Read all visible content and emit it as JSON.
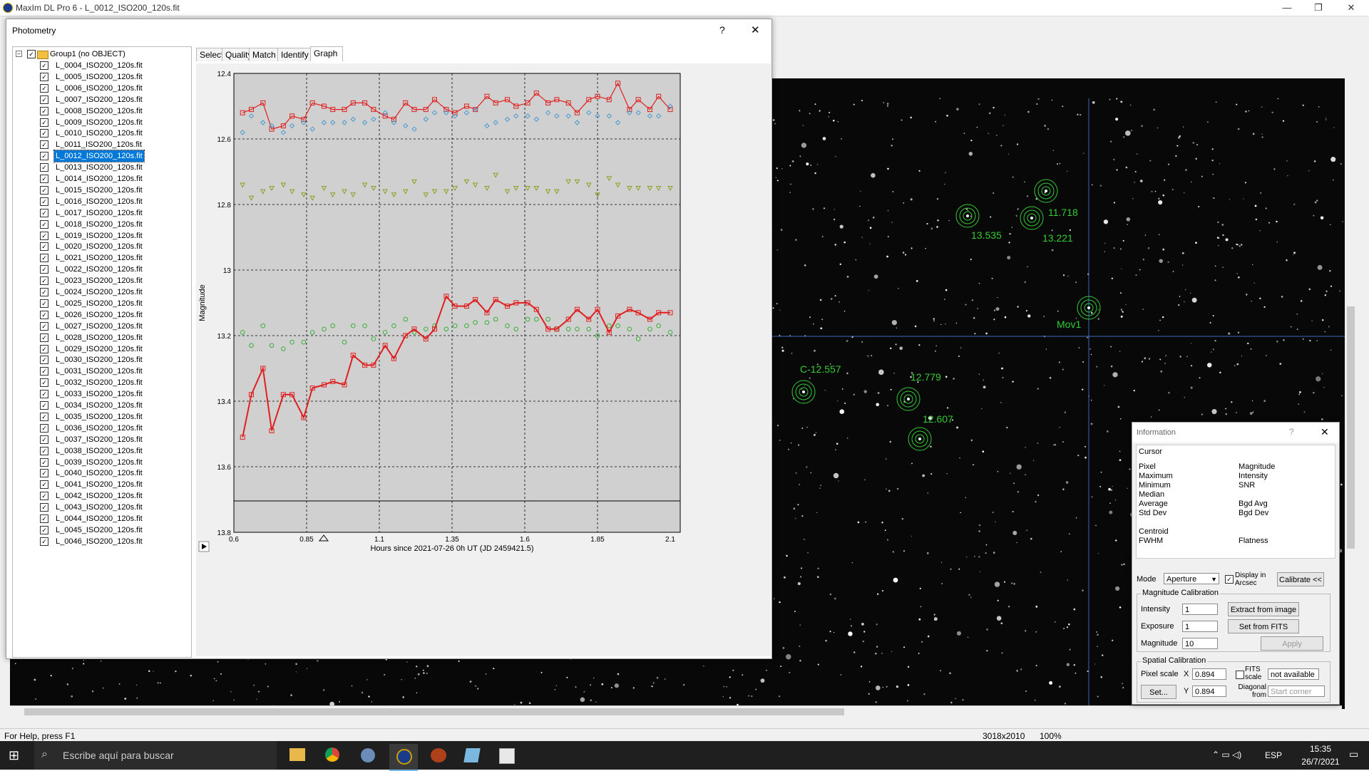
{
  "app": {
    "title": "MaxIm DL Pro 6 - L_0012_ISO200_120s.fit",
    "minimize": "—",
    "restore": "❐",
    "close": "✕"
  },
  "statusbar": {
    "help": "For Help, press F1",
    "dims": "3018x2010",
    "zoom": "100%"
  },
  "taskbar": {
    "search_placeholder": "Escribe aquí para buscar",
    "lang": "ESP",
    "time": "15:35",
    "date": "26/7/2021"
  },
  "photometry": {
    "title": "Photometry",
    "help": "?",
    "close": "✕",
    "group_label": "Group1 (no OBJECT)",
    "selected_index": 8,
    "files": [
      "L_0004_ISO200_120s.fit",
      "L_0005_ISO200_120s.fit",
      "L_0006_ISO200_120s.fit",
      "L_0007_ISO200_120s.fit",
      "L_0008_ISO200_120s.fit",
      "L_0009_ISO200_120s.fit",
      "L_0010_ISO200_120s.fit",
      "L_0011_ISO200_120s.fit",
      "L_0012_ISO200_120s.fit",
      "L_0013_ISO200_120s.fit",
      "L_0014_ISO200_120s.fit",
      "L_0015_ISO200_120s.fit",
      "L_0016_ISO200_120s.fit",
      "L_0017_ISO200_120s.fit",
      "L_0018_ISO200_120s.fit",
      "L_0019_ISO200_120s.fit",
      "L_0020_ISO200_120s.fit",
      "L_0021_ISO200_120s.fit",
      "L_0022_ISO200_120s.fit",
      "L_0023_ISO200_120s.fit",
      "L_0024_ISO200_120s.fit",
      "L_0025_ISO200_120s.fit",
      "L_0026_ISO200_120s.fit",
      "L_0027_ISO200_120s.fit",
      "L_0028_ISO200_120s.fit",
      "L_0029_ISO200_120s.fit",
      "L_0030_ISO200_120s.fit",
      "L_0031_ISO200_120s.fit",
      "L_0032_ISO200_120s.fit",
      "L_0033_ISO200_120s.fit",
      "L_0034_ISO200_120s.fit",
      "L_0035_ISO200_120s.fit",
      "L_0036_ISO200_120s.fit",
      "L_0037_ISO200_120s.fit",
      "L_0038_ISO200_120s.fit",
      "L_0039_ISO200_120s.fit",
      "L_0040_ISO200_120s.fit",
      "L_0041_ISO200_120s.fit",
      "L_0042_ISO200_120s.fit",
      "L_0043_ISO200_120s.fit",
      "L_0044_ISO200_120s.fit",
      "L_0045_ISO200_120s.fit",
      "L_0046_ISO200_120s.fit"
    ],
    "tabs": [
      "Select",
      "Quality",
      "Match",
      "Identify",
      "Graph"
    ],
    "active_tab": "Graph"
  },
  "chart_data": {
    "type": "scatter",
    "xlabel": "Hours since 2021-07-26 0h UT (JD 2459421.5)",
    "ylabel": "Magnitude",
    "xlim": [
      0.6,
      2.1
    ],
    "ylim": [
      12.4,
      13.8
    ],
    "y_inverted": true,
    "x_ticks": [
      "0.6",
      "0.85",
      "1.1",
      "1.35",
      "1.6",
      "1.85",
      "2.1"
    ],
    "y_ticks": [
      "12.4",
      "12.6",
      "12.8",
      "13",
      "13.2",
      "13.4",
      "13.6",
      "13.8"
    ],
    "grid": true,
    "background": "#d0d0d0",
    "series": [
      {
        "marker": "square-line",
        "color": "#e02020",
        "x": [
          0.63,
          0.66,
          0.7,
          0.73,
          0.77,
          0.8,
          0.84,
          0.87,
          0.91,
          0.94,
          0.98,
          1.01,
          1.05,
          1.08,
          1.12,
          1.15,
          1.19,
          1.22,
          1.26,
          1.29,
          1.33,
          1.36,
          1.4,
          1.43,
          1.47,
          1.5,
          1.54,
          1.57,
          1.61,
          1.64,
          1.68,
          1.71,
          1.75,
          1.78,
          1.82,
          1.85,
          1.89,
          1.92,
          1.96,
          1.99,
          2.03,
          2.06,
          2.1
        ],
        "y": [
          12.52,
          12.51,
          12.49,
          12.57,
          12.56,
          12.53,
          12.54,
          12.49,
          12.5,
          12.51,
          12.51,
          12.49,
          12.49,
          12.51,
          12.53,
          12.54,
          12.49,
          12.51,
          12.51,
          12.48,
          12.51,
          12.52,
          12.5,
          12.51,
          12.47,
          12.49,
          12.48,
          12.5,
          12.49,
          12.46,
          12.49,
          12.48,
          12.49,
          12.52,
          12.48,
          12.47,
          12.48,
          12.43,
          12.51,
          12.48,
          12.51,
          12.47,
          12.51
        ]
      },
      {
        "marker": "diamond",
        "color": "#4a9ad0",
        "x": [
          0.63,
          0.66,
          0.7,
          0.73,
          0.77,
          0.8,
          0.84,
          0.87,
          0.91,
          0.94,
          0.98,
          1.01,
          1.05,
          1.08,
          1.12,
          1.15,
          1.19,
          1.22,
          1.26,
          1.29,
          1.33,
          1.36,
          1.4,
          1.43,
          1.47,
          1.5,
          1.54,
          1.57,
          1.61,
          1.64,
          1.68,
          1.71,
          1.75,
          1.78,
          1.82,
          1.85,
          1.89,
          1.92,
          1.96,
          1.99,
          2.03,
          2.06,
          2.1
        ],
        "y": [
          12.58,
          12.53,
          12.55,
          12.56,
          12.58,
          12.56,
          12.55,
          12.57,
          12.55,
          12.55,
          12.55,
          12.54,
          12.55,
          12.54,
          12.52,
          12.55,
          12.56,
          12.57,
          12.54,
          12.52,
          12.52,
          12.53,
          12.52,
          12.51,
          12.56,
          12.55,
          12.54,
          12.53,
          12.53,
          12.54,
          12.52,
          12.53,
          12.53,
          12.55,
          12.52,
          12.53,
          12.53,
          12.55,
          12.52,
          12.52,
          12.53,
          12.53,
          12.5
        ]
      },
      {
        "marker": "triangle",
        "color": "#8aa020",
        "x": [
          0.63,
          0.66,
          0.7,
          0.73,
          0.77,
          0.8,
          0.84,
          0.87,
          0.91,
          0.94,
          0.98,
          1.01,
          1.05,
          1.08,
          1.12,
          1.15,
          1.19,
          1.22,
          1.26,
          1.29,
          1.33,
          1.36,
          1.4,
          1.43,
          1.47,
          1.5,
          1.54,
          1.57,
          1.61,
          1.64,
          1.68,
          1.71,
          1.75,
          1.78,
          1.82,
          1.85,
          1.89,
          1.92,
          1.96,
          1.99,
          2.03,
          2.06,
          2.1
        ],
        "y": [
          12.74,
          12.78,
          12.76,
          12.75,
          12.74,
          12.76,
          12.77,
          12.78,
          12.75,
          12.77,
          12.76,
          12.77,
          12.74,
          12.75,
          12.76,
          12.77,
          12.76,
          12.73,
          12.77,
          12.76,
          12.76,
          12.75,
          12.73,
          12.74,
          12.75,
          12.71,
          12.76,
          12.75,
          12.75,
          12.75,
          12.76,
          12.76,
          12.73,
          12.73,
          12.74,
          12.77,
          12.72,
          12.74,
          12.75,
          12.75,
          12.75,
          12.75,
          12.75
        ]
      },
      {
        "marker": "circle",
        "color": "#38b038",
        "x": [
          0.63,
          0.66,
          0.7,
          0.73,
          0.77,
          0.8,
          0.84,
          0.87,
          0.91,
          0.94,
          0.98,
          1.01,
          1.05,
          1.08,
          1.12,
          1.15,
          1.19,
          1.22,
          1.26,
          1.29,
          1.33,
          1.36,
          1.4,
          1.43,
          1.47,
          1.5,
          1.54,
          1.57,
          1.61,
          1.64,
          1.68,
          1.71,
          1.75,
          1.78,
          1.82,
          1.85,
          1.89,
          1.92,
          1.96,
          1.99,
          2.03,
          2.06,
          2.1
        ],
        "y": [
          13.19,
          13.23,
          13.17,
          13.23,
          13.24,
          13.22,
          13.22,
          13.19,
          13.18,
          13.17,
          13.22,
          13.17,
          13.17,
          13.21,
          13.19,
          13.17,
          13.15,
          13.19,
          13.18,
          13.17,
          13.18,
          13.17,
          13.17,
          13.16,
          13.16,
          13.15,
          13.17,
          13.18,
          13.15,
          13.15,
          13.15,
          13.18,
          13.18,
          13.18,
          13.18,
          13.2,
          13.17,
          13.17,
          13.18,
          13.21,
          13.18,
          13.17,
          13.19
        ]
      },
      {
        "marker": "square-line",
        "color": "#e02020",
        "x": [
          0.63,
          0.66,
          0.7,
          0.73,
          0.77,
          0.8,
          0.84,
          0.87,
          0.91,
          0.94,
          0.98,
          1.01,
          1.05,
          1.08,
          1.12,
          1.15,
          1.19,
          1.22,
          1.26,
          1.29,
          1.33,
          1.36,
          1.4,
          1.43,
          1.47,
          1.5,
          1.54,
          1.57,
          1.61,
          1.64,
          1.68,
          1.71,
          1.75,
          1.78,
          1.82,
          1.85,
          1.89,
          1.92,
          1.96,
          1.99,
          2.03,
          2.06,
          2.1
        ],
        "y": [
          13.51,
          13.38,
          13.3,
          13.49,
          13.38,
          13.38,
          13.45,
          13.36,
          13.35,
          13.34,
          13.35,
          13.26,
          13.29,
          13.29,
          13.23,
          13.27,
          13.2,
          13.18,
          13.21,
          13.18,
          13.08,
          13.11,
          13.11,
          13.09,
          13.13,
          13.09,
          13.11,
          13.1,
          13.1,
          13.12,
          13.18,
          13.18,
          13.15,
          13.12,
          13.15,
          13.12,
          13.19,
          13.14,
          13.12,
          13.13,
          13.15,
          13.13,
          13.13
        ]
      }
    ]
  },
  "image_labels": [
    {
      "text": "13.535"
    },
    {
      "text": "11.718"
    },
    {
      "text": "13.221"
    },
    {
      "text": "Mov1"
    },
    {
      "text": "C-12.557"
    },
    {
      "text": "12.779"
    },
    {
      "text": "12.607"
    }
  ],
  "info": {
    "title": "Information",
    "help": "?",
    "close": "✕",
    "cursor": "Cursor",
    "left_labels": [
      "Pixel",
      "Maximum",
      "Minimum",
      "Median",
      "Average",
      "Std Dev",
      "",
      "Centroid",
      "FWHM"
    ],
    "right_labels": [
      "Magnitude",
      "Intensity",
      "SNR",
      "",
      "Bgd Avg",
      "Bgd Dev",
      "",
      "",
      "Flatness"
    ],
    "mode_label": "Mode",
    "mode_value": "Aperture",
    "display_arcsec": "Display in Arcsec",
    "calibrate": "Calibrate <<",
    "mag_cal": "Magnitude Calibration",
    "intensity_label": "Intensity",
    "intensity": "1",
    "exposure_label": "Exposure",
    "exposure": "1",
    "magnitude_label": "Magnitude",
    "magnitude": "10",
    "extract": "Extract from image",
    "set_fits": "Set from FITS",
    "apply": "Apply",
    "spatial": "Spatial Calibration",
    "pixel_scale": "Pixel scale",
    "x_label": "X",
    "x_value": "0.894",
    "y_label": "Y",
    "y_value": "0.894",
    "fits_scale": "FITS scale",
    "not_available": "not available",
    "set": "Set...",
    "diag": "Diagonal from",
    "start_corner": "Start corner"
  },
  "colors": {
    "accent": "#0078d7",
    "star_green": "#33cc33"
  }
}
